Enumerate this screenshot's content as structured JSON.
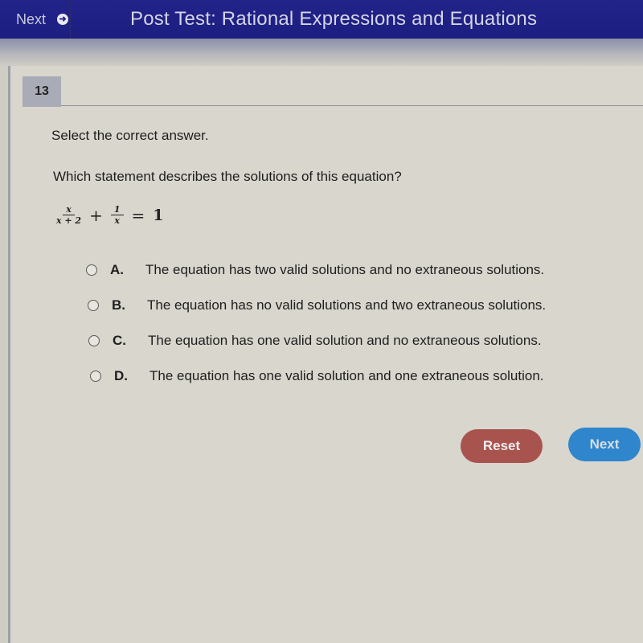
{
  "header": {
    "nav_next_label": "Next",
    "nav_next_icon": "arrow-right-circle-icon",
    "title": "Post Test: Rational Expressions and Equations"
  },
  "question": {
    "number": "13",
    "instruction": "Select the correct answer.",
    "prompt": "Which statement describes the solutions of this equation?",
    "equation": {
      "term1_numerator": "x",
      "term1_denominator": "x + 2",
      "plus": "+",
      "term2_numerator": "1",
      "term2_denominator": "x",
      "equals": "=",
      "rhs": "1"
    },
    "options": [
      {
        "letter": "A.",
        "text": "The equation has two valid solutions and no extraneous solutions.",
        "selected": false
      },
      {
        "letter": "B.",
        "text": "The equation has no valid solutions and two extraneous solutions.",
        "selected": false
      },
      {
        "letter": "C.",
        "text": "The equation has one valid solution and no extraneous solutions.",
        "selected": false
      },
      {
        "letter": "D.",
        "text": "The equation has one valid solution and one extraneous solution.",
        "selected": false
      }
    ]
  },
  "buttons": {
    "reset_label": "Reset",
    "next_label": "Next"
  },
  "colors": {
    "header_bg": "#1f2085",
    "reset_bg": "#a9534f",
    "next_bg": "#2f86cc"
  }
}
